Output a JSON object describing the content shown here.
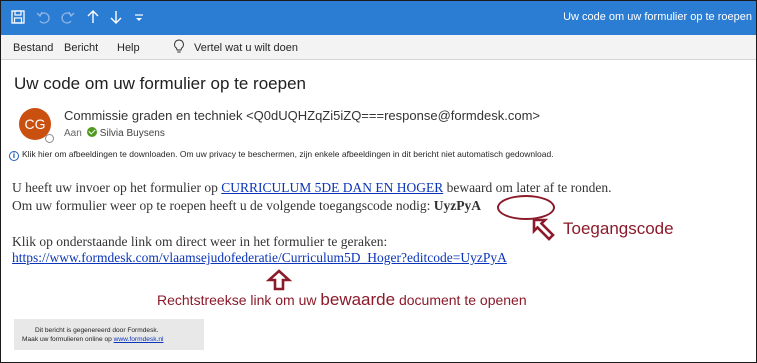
{
  "window": {
    "title": "Uw code om uw formulier op te roepen"
  },
  "quick_access": {
    "icons": [
      "save-icon",
      "undo-icon",
      "redo-icon",
      "previous-item-icon",
      "next-item-icon",
      "customize-toolbar-icon"
    ]
  },
  "menu": {
    "items": [
      "Bestand",
      "Bericht",
      "Help"
    ],
    "tell_me": "Vertel wat u wilt doen"
  },
  "email": {
    "subject": "Uw code om uw formulier op te roepen",
    "avatar_initials": "CG",
    "avatar_color": "#ca5010",
    "sender": "Commissie graden en techniek <Q0dUQHZqZi5iZQ===response@formdesk.com>",
    "to_label": "Aan",
    "recipient": "Silvia Buysens",
    "info_text": "Klik hier om afbeeldingen te downloaden. Om uw privacy te beschermen, zijn enkele afbeeldingen in dit bericht niet automatisch gedownload.",
    "line1_before": "U heeft uw invoer op het formulier op ",
    "line1_link": "CURRICULUM 5DE DAN EN HOGER",
    "line1_after": " bewaard om later af te ronden.",
    "line2_before": "Om uw formulier weer op te roepen heeft u de volgende toegangscode nodig: ",
    "access_code": "UyzPyA",
    "line3": "Klik op onderstaande link om direct weer in het formulier te geraken:",
    "edit_link": "https://www.formdesk.com/vlaamsejudofederatie/Curriculum5D_Hoger?editcode=UyzPyA",
    "footer_line1": "Dit bericht is gegenereerd door Formdesk.",
    "footer_line2_before": "Maak uw formulieren online op ",
    "footer_link": "www.formdesk.nl"
  },
  "annotations": {
    "code_label": "Toegangscode",
    "link_label_before": "Rechtstreekse link om uw ",
    "link_label_emphasis": "bewaarde",
    "link_label_after": " document te openen",
    "color": "#8b1a2a"
  }
}
